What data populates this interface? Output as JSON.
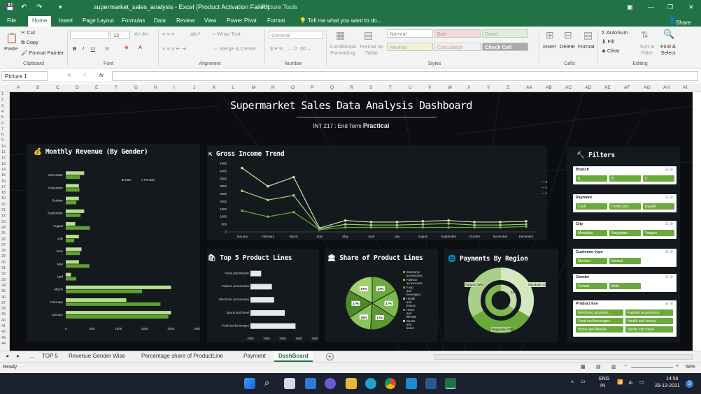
{
  "window": {
    "title": "supermarket_sales_analysis - Excel (Product Activation Failed)",
    "context": "Picture Tools"
  },
  "tabs": [
    "File",
    "Home",
    "Insert",
    "Page Layout",
    "Formulas",
    "Data",
    "Review",
    "View",
    "Power Pivot",
    "Format"
  ],
  "tell_me": "Tell me what you want to do...",
  "share": "Share",
  "ribbon": {
    "clipboard": {
      "paste": "Paste",
      "cut": "Cut",
      "copy": "Copy",
      "painter": "Format Painter",
      "label": "Clipboard"
    },
    "font": {
      "size": "12",
      "label": "Font"
    },
    "alignment": {
      "wrap": "Wrap Text",
      "merge": "Merge & Center",
      "label": "Alignment"
    },
    "number": {
      "format": "General",
      "label": "Number"
    },
    "styles": {
      "cond": "Conditional Formatting",
      "table": "Format as Table",
      "normal": "Normal",
      "bad": "Bad",
      "good": "Good",
      "neutral": "Neutral",
      "calc": "Calculation",
      "check": "Check Cell",
      "label": "Styles"
    },
    "cells": {
      "insert": "Insert",
      "delete": "Delete",
      "format": "Format",
      "label": "Cells"
    },
    "editing": {
      "autosum": "AutoSum",
      "fill": "Fill",
      "clear": "Clear",
      "sort": "Sort & Filter",
      "find": "Find & Select",
      "label": "Editing"
    }
  },
  "name_box": "Picture 1",
  "fx": "fx",
  "columns": [
    "A",
    "B",
    "C",
    "D",
    "E",
    "F",
    "G",
    "H",
    "I",
    "J",
    "K",
    "L",
    "M",
    "N",
    "O",
    "P",
    "Q",
    "R",
    "S",
    "T",
    "U",
    "V",
    "W",
    "X",
    "Y",
    "Z",
    "AA",
    "AB",
    "AC",
    "AD",
    "AE",
    "AF",
    "AG",
    "AH",
    "AI"
  ],
  "dashboard": {
    "title": "Supermarket Sales Data Analysis Dashboard",
    "subtitle": "INT 217 : End Term",
    "subtitle_bold": "Practical",
    "revenue": {
      "title": "Monthly Revenue (By Gender)",
      "legend_male": "Male",
      "legend_female": "Female"
    },
    "gross": {
      "title": "Gross Income Trend",
      "legend": [
        "B",
        "C",
        "A"
      ]
    },
    "top5": {
      "title": "Top 5 Product Lines"
    },
    "share": {
      "title": "Share of Product Lines"
    },
    "payments": {
      "title": "Payments By Region",
      "yangon": "Yangon 34%",
      "mandalay": "Mandalay 33%",
      "naypyitaw": "Naypyitaw 33%",
      "inner_a": "33%",
      "inner_b": "33%",
      "inner_c": "34%"
    },
    "filters": {
      "title": "Filters",
      "groups": [
        {
          "name": "Branch",
          "items": [
            "A",
            "B",
            "C"
          ]
        },
        {
          "name": "Payment",
          "items": [
            "Cash",
            "Credit card",
            "Ewallet"
          ]
        },
        {
          "name": "City",
          "items": [
            "Mandalay",
            "Naypyitaw",
            "Yangon"
          ]
        },
        {
          "name": "Customer type",
          "items": [
            "Member",
            "Normal"
          ]
        },
        {
          "name": "Gender",
          "items": [
            "Female",
            "Male"
          ]
        },
        {
          "name": "Product line",
          "items": [
            "Electronic accessor...",
            "Fashion accessories",
            "Food and beverages",
            "Health and beauty",
            "Home and lifestyle",
            "Sports and travel"
          ]
        }
      ]
    }
  },
  "chart_data": [
    {
      "type": "bar",
      "title": "Monthly Revenue (By Gender)",
      "categories": [
        "January",
        "February",
        "March",
        "April",
        "May",
        "June",
        "July",
        "August",
        "September",
        "October",
        "November",
        "December"
      ],
      "series": [
        {
          "name": "Male",
          "values": [
            2000,
            1150,
            2000,
            100,
            250,
            300,
            250,
            180,
            350,
            250,
            250,
            350
          ]
        },
        {
          "name": "Female",
          "values": [
            1950,
            1800,
            1450,
            200,
            450,
            270,
            160,
            460,
            280,
            200,
            260,
            270
          ]
        }
      ],
      "xticks": [
        "0",
        "500",
        "1000",
        "1500",
        "2000",
        "2500"
      ],
      "xlim": [
        0,
        2500
      ],
      "colors": {
        "Male": "#b7e08c",
        "Female": "#5fa030"
      }
    },
    {
      "type": "line",
      "title": "Gross Income Trend",
      "categories": [
        "January",
        "February",
        "March",
        "April",
        "May",
        "June",
        "July",
        "August",
        "September",
        "October",
        "November",
        "December"
      ],
      "yticks": [
        "0",
        "500",
        "1000",
        "1500",
        "2000",
        "2500",
        "3000",
        "3500",
        "4000",
        "4500"
      ],
      "ylim": [
        0,
        4500
      ],
      "series": [
        {
          "name": "B",
          "values": [
            4200,
            3000,
            3600,
            250,
            750,
            650,
            650,
            700,
            750,
            650,
            650,
            700
          ]
        },
        {
          "name": "C",
          "values": [
            2700,
            2100,
            2400,
            200,
            500,
            450,
            450,
            500,
            550,
            450,
            450,
            500
          ]
        },
        {
          "name": "A",
          "values": [
            1400,
            1000,
            1300,
            150,
            300,
            300,
            300,
            300,
            300,
            300,
            300,
            350
          ]
        }
      ]
    },
    {
      "type": "bar",
      "title": "Top 5 Product Lines",
      "categories": [
        "Home and lifestyle",
        "Fashion accessories",
        "Electronic accessories",
        "Sports and travel",
        "Food and beverages"
      ],
      "values": [
        2750,
        3000,
        3050,
        3300,
        3550
      ],
      "xticks": [
        "2500",
        "2550",
        "3000",
        "3500",
        "4000"
      ],
      "xlim": [
        2500,
        4000
      ]
    },
    {
      "type": "pie",
      "title": "Share of Product Lines",
      "labels": [
        "Electronic accessories",
        "Fashion accessories",
        "Food and beverages",
        "Health and beauty",
        "Home and lifestyle",
        "Sports and travel"
      ],
      "values": [
        17,
        17,
        17,
        15,
        17,
        17
      ]
    },
    {
      "type": "pie",
      "title": "Payments By Region",
      "labels": [
        "Yangon",
        "Mandalay",
        "Naypyitaw"
      ],
      "values": [
        34,
        33,
        33
      ]
    }
  ],
  "sheets": [
    "TOP 5",
    "Revenue Gender Wise",
    "Percentage share of ProductLine",
    "Payment",
    "DashBoard"
  ],
  "status": {
    "ready": "Ready",
    "zoom": "68%"
  },
  "taskbar": {
    "lang": "ENG",
    "region": "IN",
    "time": "14:56",
    "date": "29-12-2021",
    "badge": "3"
  }
}
